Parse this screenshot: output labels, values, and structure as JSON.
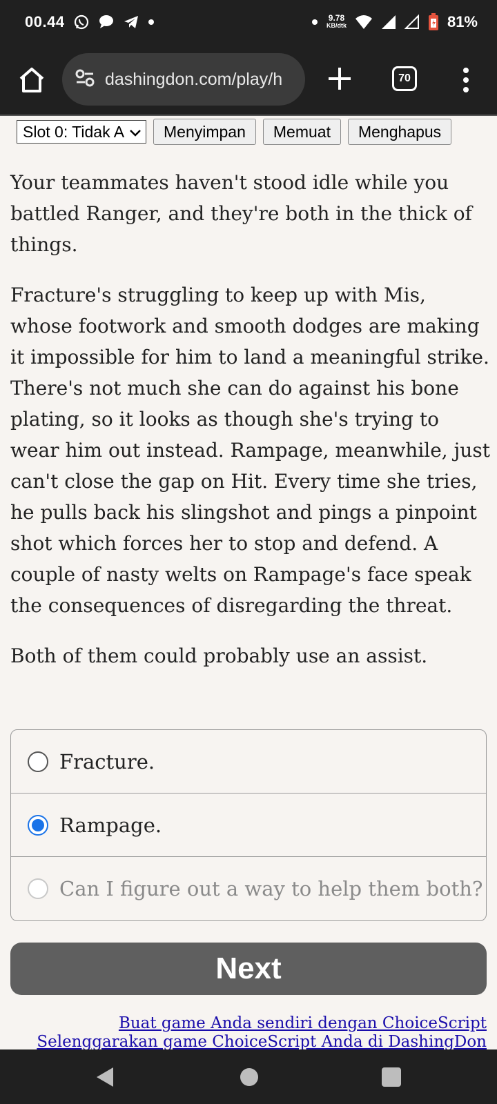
{
  "status_bar": {
    "time": "00.44",
    "net_speed_value": "9.78",
    "net_speed_unit": "KB/dtk",
    "battery_percent": "81%",
    "notification_icons": [
      "whatsapp-icon",
      "chat-bubble-icon",
      "telegram-icon",
      "dot-icon"
    ],
    "system_icons": [
      "dot-icon",
      "wifi-icon",
      "signal-icon",
      "signal-empty-icon",
      "battery-icon"
    ]
  },
  "browser": {
    "url": "dashingdon.com/play/h",
    "tab_count": "70"
  },
  "save_controls": {
    "slot_select_value": "Slot 0: Tidak A",
    "save_label": "Menyimpan",
    "load_label": "Memuat",
    "delete_label": "Menghapus"
  },
  "story": {
    "paragraphs": [
      "Your teammates haven't stood idle while you battled Ranger, and they're both in the thick of things.",
      "Fracture's struggling to keep up with Mis, whose footwork and smooth dodges are making it impossible for him to land a meaningful strike. There's not much she can do against his bone plating, so it looks as though she's trying to wear him out instead. Rampage, meanwhile, just can't close the gap on Hit. Every time she tries, he pulls back his slingshot and pings a pinpoint shot which forces her to stop and defend. A couple of nasty welts on Rampage's face speak the consequences of disregarding the threat.",
      "Both of them could probably use an assist."
    ]
  },
  "choices": [
    {
      "label": "Fracture.",
      "selected": false,
      "disabled": false
    },
    {
      "label": "Rampage.",
      "selected": true,
      "disabled": false
    },
    {
      "label": "Can I figure out a way to help them both?",
      "selected": false,
      "disabled": true
    }
  ],
  "next_label": "Next",
  "footer": {
    "link1": "Buat game Anda sendiri dengan ChoiceScript",
    "link2": "Selenggarakan game ChoiceScript Anda di DashingDon"
  },
  "colors": {
    "accent": "#1a73e8",
    "next_button": "#5f5f5f",
    "link": "#1a0dab",
    "page_bg": "#f7f4f1"
  }
}
